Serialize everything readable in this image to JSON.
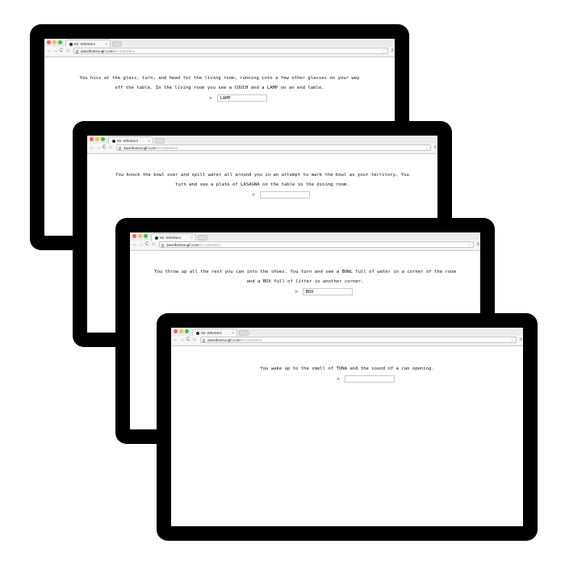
{
  "browser": {
    "tab_title": "Mr. Whiskers",
    "tab_close": "×",
    "url_domain": "davidhartsough.com",
    "url_path": "/mr-whiskers/",
    "back_icon": "←",
    "forward_icon": "→",
    "reload_icon": "C",
    "home_icon": "⌂",
    "star_icon": "☆",
    "menu_icon": "≡"
  },
  "prompt_symbol": ">",
  "screens": [
    {
      "story": "You hiss at the glass, turn, and head for the living room, running into a few other glasses on your way off the table. In the living room you see a COUCH and a LAMP on an end table.",
      "input_value": "LAMP"
    },
    {
      "story": "You knock the bowl over and spill water all around you in an attempt to mark the bowl as your territory. You turn and see a plate of LASAGNA on the table in the dining room.",
      "input_value": ""
    },
    {
      "story": "You throw up all the rest you can into the shoes. You turn and see a BOWL full of water in a corner of the room and a BOX full of litter in another corner.",
      "input_value": "BOX"
    },
    {
      "story": "You wake up to the smell of TUNA and the sound of a can opening.",
      "input_value": ""
    }
  ]
}
